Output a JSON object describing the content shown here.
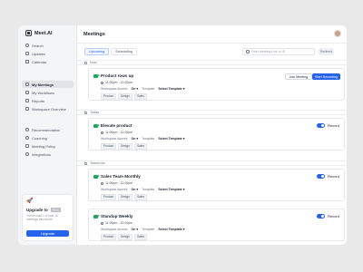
{
  "app": {
    "name": "Meet.AI"
  },
  "sidebar": {
    "items": [
      {
        "label": "Search",
        "icon": "search-icon"
      },
      {
        "label": "Updates",
        "icon": "bell-icon"
      },
      {
        "label": "Calendar",
        "icon": "calendar-icon"
      },
      {
        "label": "My Meetings",
        "icon": "video-icon"
      },
      {
        "label": "My Workflows",
        "icon": "workflow-icon"
      },
      {
        "label": "Reports",
        "icon": "reports-icon"
      },
      {
        "label": "Workspace Overview",
        "icon": "grid-icon"
      },
      {
        "label": "Recommendation",
        "icon": "star-icon"
      },
      {
        "label": "Coaching",
        "icon": "coaching-icon"
      },
      {
        "label": "Meeting Policy",
        "icon": "policy-icon"
      },
      {
        "label": "Integrations",
        "icon": "plug-icon"
      }
    ],
    "upgrade": {
      "title": "Upgrade to",
      "badge": "PRO",
      "text": "You've used 1 of your 10 meetings this month",
      "button": "Upgrade"
    }
  },
  "header": {
    "title": "Meetings"
  },
  "tabs": [
    {
      "label": "Upcoming"
    },
    {
      "label": "Scheduling"
    }
  ],
  "search": {
    "placeholder": "Enter Meeting Link or ID",
    "button": "Redirect"
  },
  "sections": {
    "now": "Now",
    "today": "Today",
    "tomorrow": "Tomorrow"
  },
  "labels": {
    "workspace_access": "Workspace Access",
    "template": "Template",
    "on": "On",
    "select_template": "Select Template",
    "record": "Record",
    "join": "Join Meeting",
    "start": "Start Recording"
  },
  "meetings": [
    {
      "title": "Product rows up",
      "time": "11:00pm - 12:00pm",
      "tags": [
        "Product",
        "Design",
        "Sales"
      ]
    },
    {
      "title": "Elevate product",
      "time": "11:00pm - 12:00pm",
      "tags": [
        "Product",
        "Design",
        "Sales"
      ]
    },
    {
      "title": "Sales Team Monthly",
      "time": "11:00pm - 12:00pm",
      "tags": [
        "Product",
        "Design",
        "Sales"
      ]
    },
    {
      "title": "Standup Weekly",
      "time": "11:00pm - 12:00pm",
      "tags": [
        "Product",
        "Design",
        "Sales"
      ]
    }
  ],
  "colors": {
    "accent": "#2563eb",
    "meeting_icon": "#22a55a",
    "rocket": "#e0553b"
  }
}
